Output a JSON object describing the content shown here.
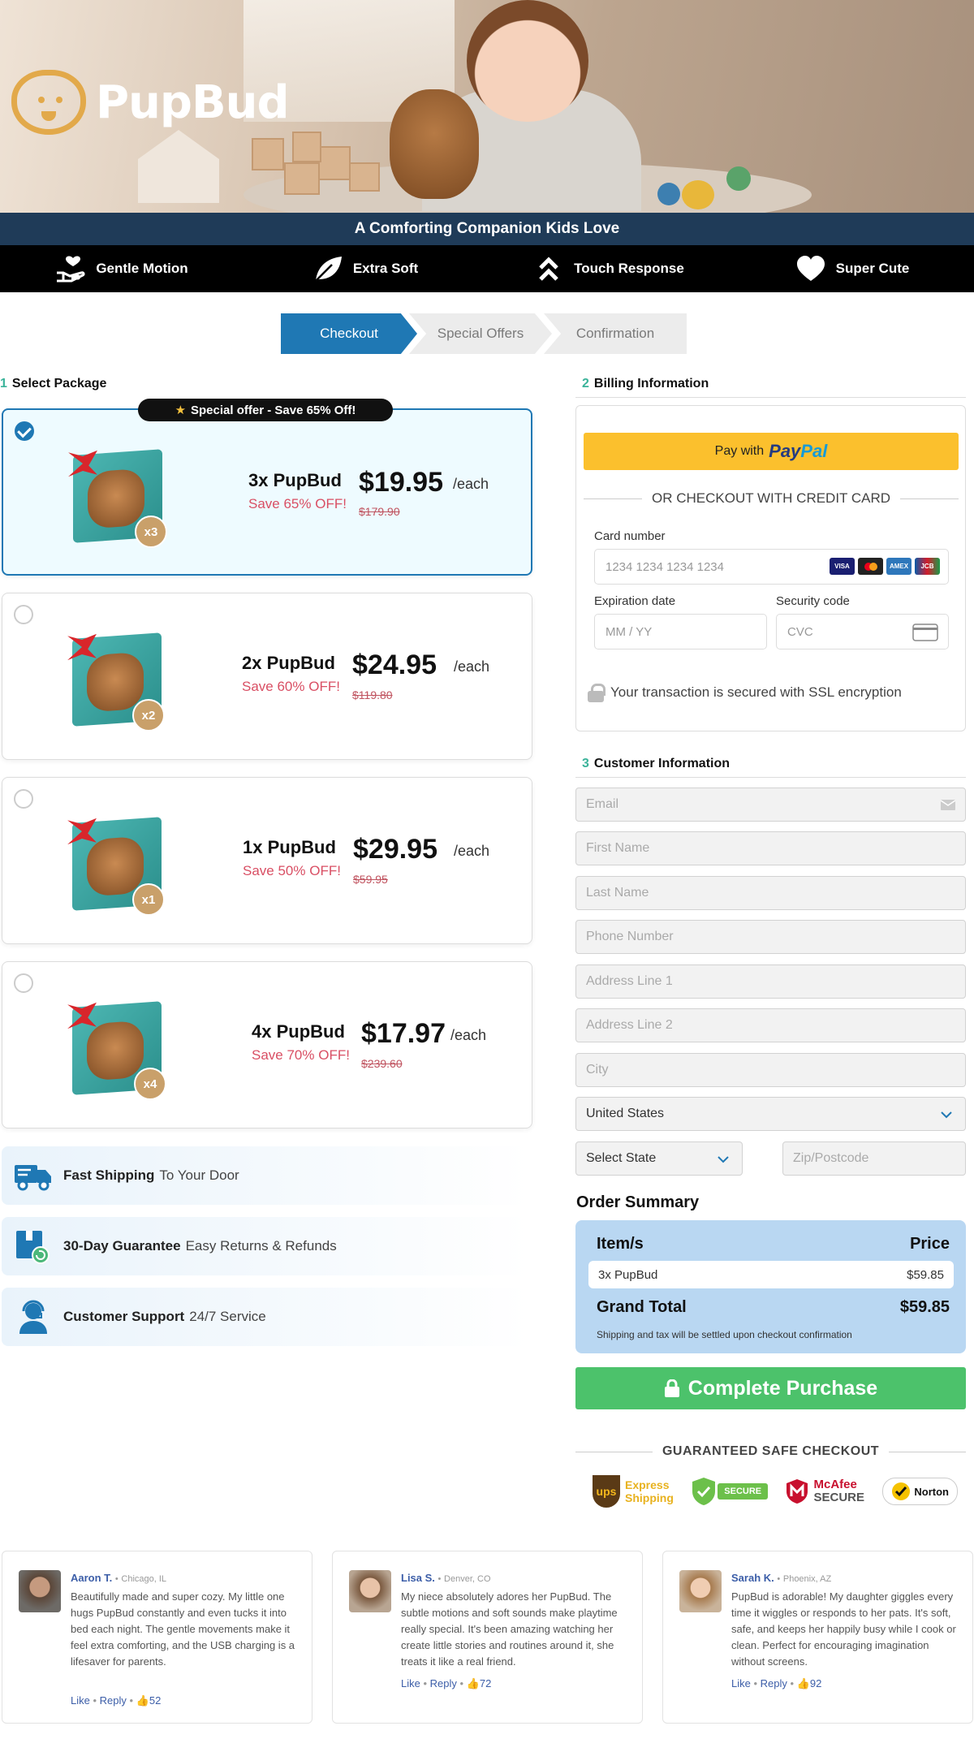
{
  "brand": {
    "name": "PupBud",
    "tagline": "A Comforting Companion Kids Love"
  },
  "features": [
    {
      "icon": "hand-heart-icon",
      "label": "Gentle Motion"
    },
    {
      "icon": "leaf-icon",
      "label": "Extra Soft"
    },
    {
      "icon": "double-chevron-up-icon",
      "label": "Touch Response"
    },
    {
      "icon": "heart-icon",
      "label": "Super Cute"
    }
  ],
  "steps": [
    "Checkout",
    "Special Offers",
    "Confirmation"
  ],
  "select_package": {
    "num": "1",
    "title": "Select Package",
    "special_offer": "Special offer - Save 65% Off!"
  },
  "packages": [
    {
      "name": "3x PupBud",
      "save": "Save 65% OFF!",
      "price": "$19.95",
      "each": "/each",
      "old": "$179.90",
      "badge": "x3",
      "selected": true
    },
    {
      "name": "2x PupBud",
      "save": "Save 60% OFF!",
      "price": "$24.95",
      "each": "/each",
      "old": "$119.80",
      "badge": "x2",
      "selected": false
    },
    {
      "name": "1x PupBud",
      "save": "Save 50% OFF!",
      "price": "$29.95",
      "each": "/each",
      "old": "$59.95",
      "badge": "x1",
      "selected": false
    },
    {
      "name": "4x PupBud",
      "save": "Save 70% OFF!",
      "price": "$17.97",
      "each": "/each",
      "old": "$239.60",
      "badge": "x4",
      "selected": false
    }
  ],
  "trust": [
    {
      "icon": "truck-icon",
      "bold": "Fast Shipping",
      "text": "To Your Door"
    },
    {
      "icon": "box-return-icon",
      "bold": "30-Day Guarantee",
      "text": "Easy Returns & Refunds"
    },
    {
      "icon": "headset-agent-icon",
      "bold": "Customer Support",
      "text": "24/7 Service"
    }
  ],
  "billing": {
    "num": "2",
    "title": "Billing Information",
    "paypal_prefix": "Pay with",
    "paypal_brand_a": "Pay",
    "paypal_brand_b": "Pal",
    "or_text": "OR CHECKOUT WITH CREDIT CARD",
    "card_label": "Card number",
    "card_placeholder": "1234 1234 1234 1234",
    "exp_label": "Expiration date",
    "exp_placeholder": "MM / YY",
    "cvc_label": "Security code",
    "cvc_placeholder": "CVC",
    "ssl": "Your transaction is secured with SSL encryption"
  },
  "customer": {
    "num": "3",
    "title": "Customer Information",
    "email": "Email",
    "first": "First Name",
    "last": "Last Name",
    "phone": "Phone Number",
    "addr1": "Address Line 1",
    "addr2": "Address Line 2",
    "city": "City",
    "country": "United States",
    "state": "Select State",
    "zip": "Zip/Postcode"
  },
  "summary": {
    "title": "Order Summary",
    "item_h": "Item/s",
    "price_h": "Price",
    "item": "3x PupBud",
    "item_price": "$59.85",
    "total_label": "Grand Total",
    "total": "$59.85",
    "note": "Shipping and tax will be settled upon checkout confirmation"
  },
  "purchase_label": "Complete Purchase",
  "safe_checkout": "GUARANTEED SAFE CHECKOUT",
  "security_logos": {
    "ups_a": "Express",
    "ups_b": "Shipping",
    "ups": "ups",
    "secure": "SECURE",
    "mcafee_a": "McAfee",
    "mcafee_b": "SECURE",
    "norton": "Norton"
  },
  "reviews": [
    {
      "name": "Aaron T.",
      "loc": "Chicago, IL",
      "text": "Beautifully made and super cozy. My little one hugs PupBud constantly and even tucks it into bed each night. The gentle movements make it feel extra comforting, and the USB charging is a lifesaver for parents.",
      "likes": "52"
    },
    {
      "name": "Lisa S.",
      "loc": "Denver, CO",
      "text": "My niece absolutely adores her PupBud. The subtle motions and soft sounds make playtime really special. It's been amazing watching her create little stories and routines around it, she treats it like a real friend.",
      "likes": "72"
    },
    {
      "name": "Sarah K.",
      "loc": "Phoenix, AZ",
      "text": "PupBud is adorable! My daughter giggles every time it wiggles or responds to her pats. It's soft, safe, and keeps her happily busy while I cook or clean. Perfect for encouraging imagination without screens.",
      "likes": "92"
    }
  ],
  "review_actions": {
    "like": "Like",
    "reply": "Reply",
    "dot": "•"
  }
}
